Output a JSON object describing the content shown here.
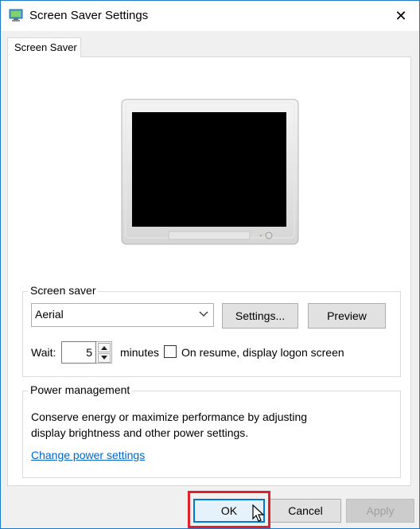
{
  "window": {
    "title": "Screen Saver Settings",
    "close_glyph": "✕"
  },
  "tabs": [
    {
      "label": "Screen Saver",
      "selected": true
    }
  ],
  "screen_saver": {
    "group_label": "Screen saver",
    "selected": "Aerial",
    "settings_label": "Settings...",
    "preview_label": "Preview",
    "wait_label": "Wait:",
    "wait_value": "5",
    "minutes_label": "minutes",
    "resume_label": "On resume, display logon screen",
    "resume_checked": false
  },
  "power": {
    "group_label": "Power management",
    "description_line1": "Conserve energy or maximize performance by adjusting",
    "description_line2": "display brightness and other power settings.",
    "link_label": "Change power settings"
  },
  "footer": {
    "ok_label": "OK",
    "cancel_label": "Cancel",
    "apply_label": "Apply",
    "apply_disabled": true
  },
  "colors": {
    "accent": "#0078d7",
    "highlight": "#e0202b",
    "link": "#0066cc"
  },
  "icons": [
    "screen-saver-app-icon",
    "close-icon",
    "chevron-down-icon",
    "spin-up-icon",
    "spin-down-icon",
    "monitor-illustration",
    "mouse-cursor-icon"
  ]
}
